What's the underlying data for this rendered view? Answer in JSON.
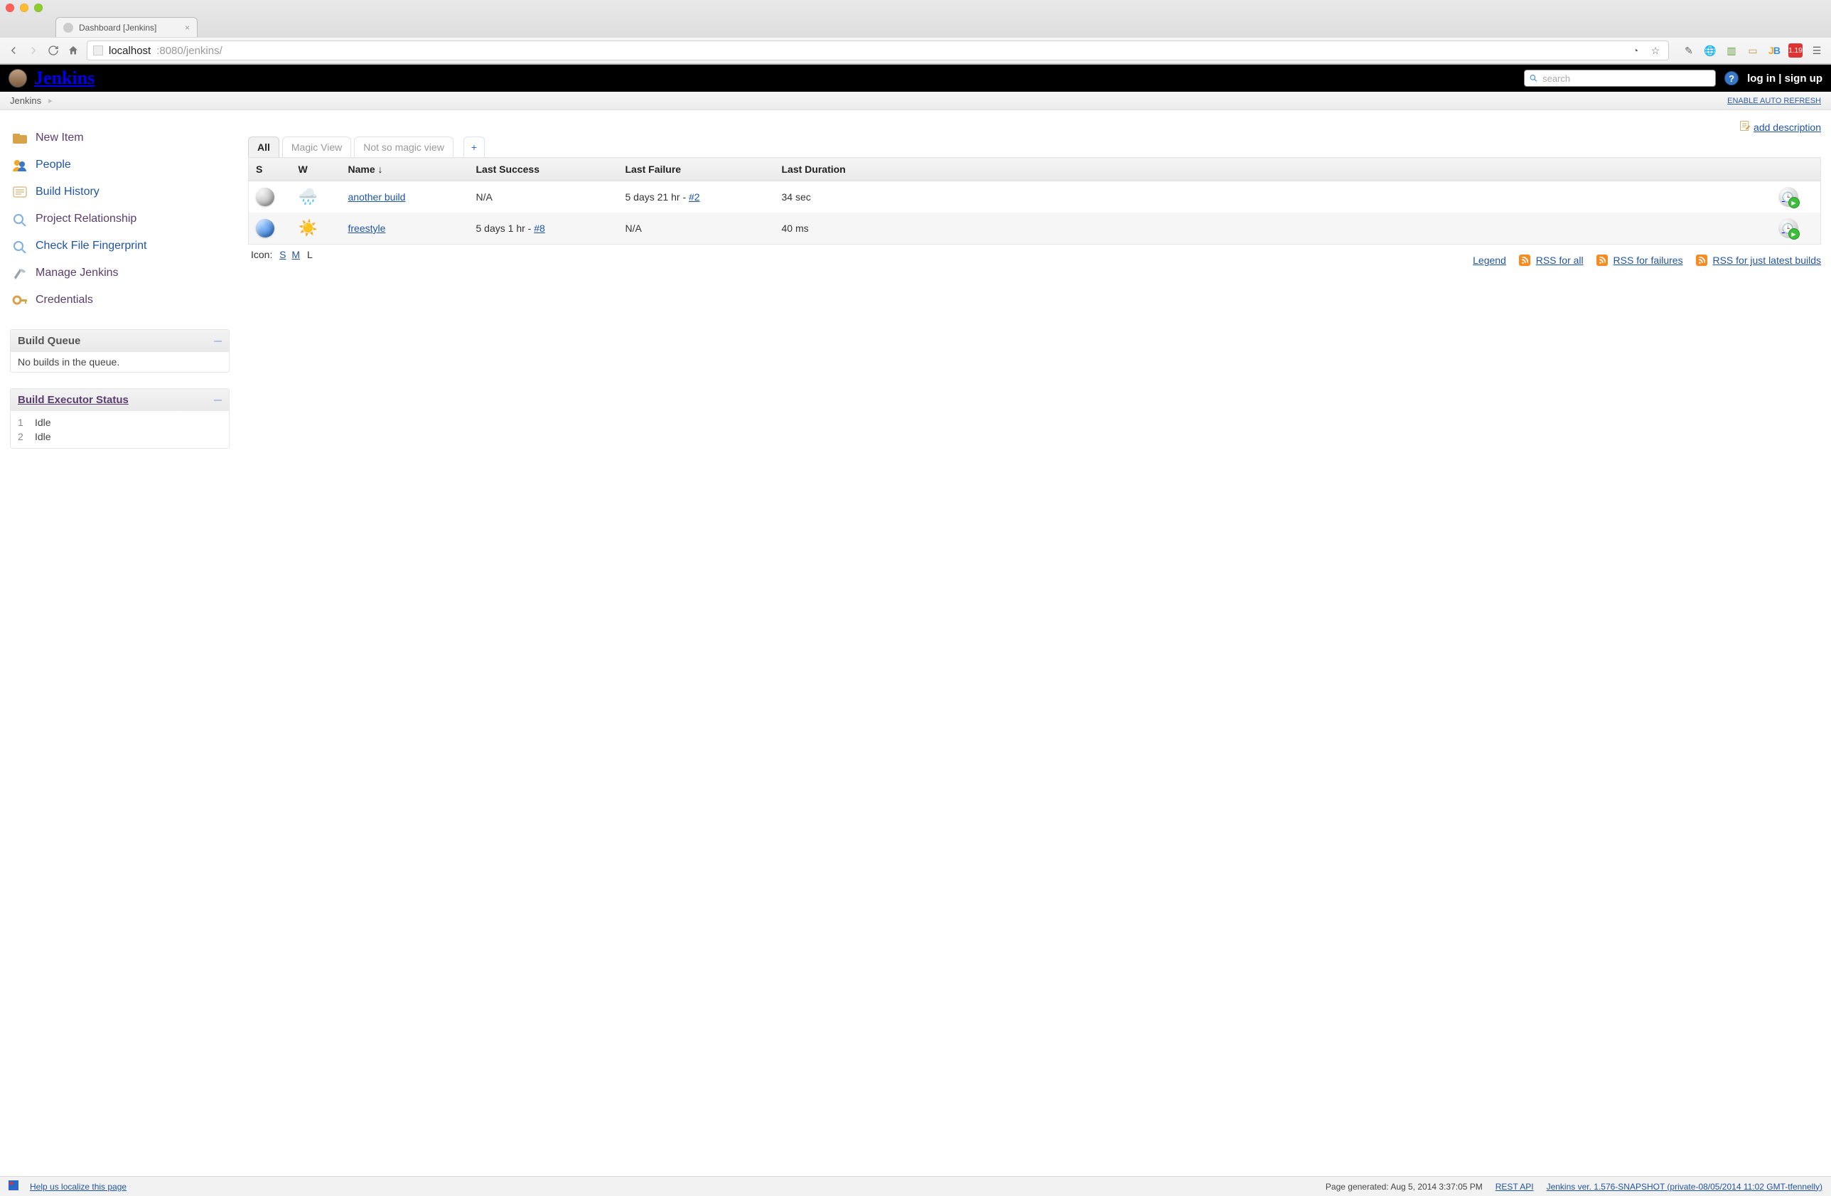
{
  "browser": {
    "tab_title": "Dashboard [Jenkins]",
    "url_host": "localhost",
    "url_rest": ":8080/jenkins/",
    "ext_badge": "1.19"
  },
  "header": {
    "brand": "Jenkins",
    "search_placeholder": "search",
    "login": "log in",
    "signup": "sign up"
  },
  "breadcrumb": {
    "root": "Jenkins",
    "auto_refresh": "ENABLE AUTO REFRESH"
  },
  "sidebar": {
    "items": [
      {
        "label": "New Item",
        "color": "purple"
      },
      {
        "label": "People",
        "color": "blue"
      },
      {
        "label": "Build History",
        "color": "blue"
      },
      {
        "label": "Project Relationship",
        "color": "purple"
      },
      {
        "label": "Check File Fingerprint",
        "color": "blue"
      },
      {
        "label": "Manage Jenkins",
        "color": "purple"
      },
      {
        "label": "Credentials",
        "color": "purple"
      }
    ],
    "queue": {
      "title": "Build Queue",
      "empty": "No builds in the queue."
    },
    "executors": {
      "title": "Build Executor Status",
      "rows": [
        {
          "n": "1",
          "state": "Idle"
        },
        {
          "n": "2",
          "state": "Idle"
        }
      ]
    }
  },
  "content": {
    "add_desc": "add description",
    "tabs": [
      {
        "label": "All",
        "active": true
      },
      {
        "label": "Magic View"
      },
      {
        "label": "Not so magic view"
      }
    ],
    "columns": {
      "s": "S",
      "w": "W",
      "name": "Name  ↓",
      "last_success": "Last Success",
      "last_failure": "Last Failure",
      "last_duration": "Last Duration"
    },
    "rows": [
      {
        "status": "grey",
        "weather": "🌧️",
        "name": "another build",
        "last_success": "N/A",
        "last_failure_text": "5 days 21 hr - ",
        "last_failure_link": "#2",
        "last_duration": "34 sec"
      },
      {
        "status": "blue",
        "weather": "☀️",
        "name": "freestyle",
        "last_success_text": "5 days 1 hr - ",
        "last_success_link": "#8",
        "last_failure": "N/A",
        "last_duration": "40 ms"
      }
    ],
    "icon_label": "Icon:",
    "icon_sizes": {
      "s": "S",
      "m": "M",
      "l": "L"
    },
    "legend": "Legend",
    "rss": {
      "all": "RSS for all",
      "failures": "RSS for failures",
      "latest": "RSS for just latest builds"
    }
  },
  "footer": {
    "localize": "Help us localize this page",
    "generated": "Page generated: Aug 5, 2014 3:37:05 PM",
    "rest_api": "REST API",
    "version": "Jenkins ver. 1.576-SNAPSHOT (private-08/05/2014 11:02 GMT-tfennelly)"
  }
}
